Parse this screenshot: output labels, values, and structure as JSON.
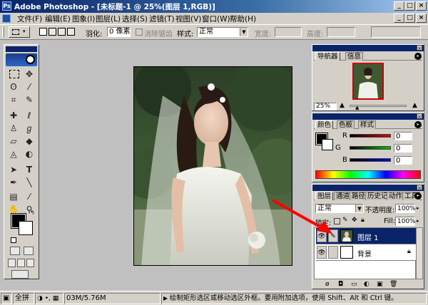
{
  "window": {
    "title": "Adobe Photoshop - [未标题-1 @ 25%(图层 1,RGB)]",
    "controls": [
      "_",
      "□",
      "×"
    ]
  },
  "menubar": {
    "items": [
      "文件(F)",
      "编辑(E)",
      "图象(I)",
      "图层(L)",
      "选择(S)",
      "滤镜(T)",
      "视图(V)",
      "窗口(W)",
      "帮助(H)"
    ],
    "doc_controls": [
      "_",
      "□",
      "×"
    ]
  },
  "options": {
    "feather_label": "羽化:",
    "feather_value": "0 像素",
    "antialias_label": "消除锯齿",
    "style_label": "样式:",
    "style_value": "正常",
    "width_label": "宽度:",
    "height_label": "高度:"
  },
  "navigator": {
    "tabs": [
      "导航器",
      "信息"
    ],
    "zoom": "25%"
  },
  "color_panel": {
    "tabs": [
      "颜色",
      "色板",
      "样式"
    ],
    "channels": [
      {
        "label": "R",
        "value": "0",
        "color": "#e00000"
      },
      {
        "label": "G",
        "value": "0",
        "color": "#00c000"
      },
      {
        "label": "B",
        "value": "0",
        "color": "#0000e0"
      }
    ]
  },
  "layers_panel": {
    "tabs": [
      "图层",
      "通道",
      "路径",
      "历史记录",
      "动作",
      "工具"
    ],
    "blend_mode": "正常",
    "opacity_label": "不透明度:",
    "opacity_value": "100%",
    "lock_label": "锁定:",
    "fill_label": "Fill:",
    "fill_value": "100%",
    "layers": [
      {
        "name": "图层 1",
        "selected": true
      },
      {
        "name": "背景",
        "selected": false
      }
    ]
  },
  "statusbar": {
    "zoom": "全拼",
    "doc_size": "03M/5.76M",
    "hint": "绘制矩形选区或移动选区外框。要用附加选项，使用 Shift、Alt 和 Ctrl 键。"
  },
  "colors": {
    "title_active": "#0a246a",
    "selection": "#0a246a",
    "arrow": "#ff0000"
  }
}
